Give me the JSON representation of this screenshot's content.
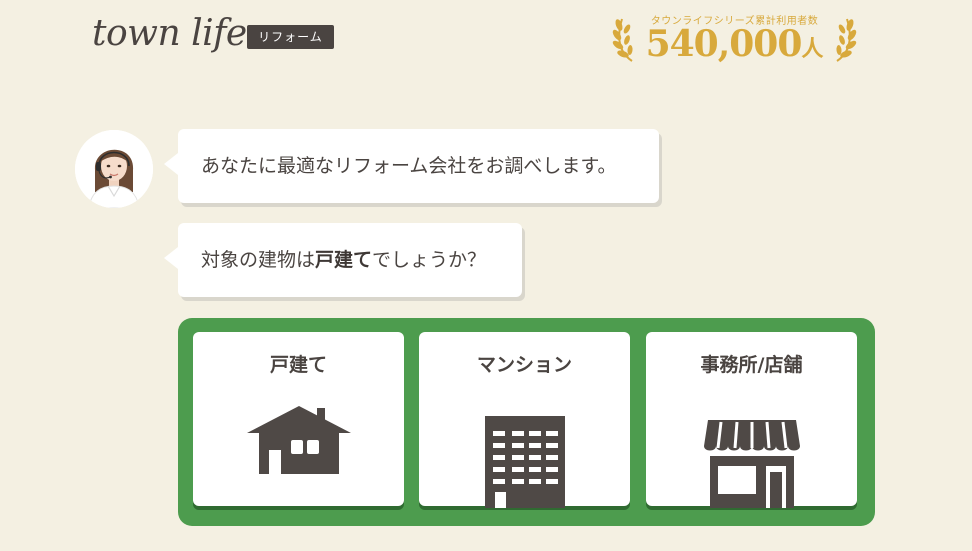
{
  "header": {
    "logo_text": "town life",
    "logo_badge": "リフォーム",
    "stat_caption": "タウンライフシリーズ累計利用者数",
    "stat_number": "540,000",
    "stat_unit": "人"
  },
  "chat": {
    "message_1": "あなたに最適なリフォーム会社をお調べします。",
    "message_2_prefix": "対象の建物は",
    "message_2_emphasis": "戸建て",
    "message_2_suffix": "でしょうか？"
  },
  "options": [
    {
      "label": "戸建て",
      "icon": "house-icon"
    },
    {
      "label": "マンション",
      "icon": "apartment-building-icon"
    },
    {
      "label": "事務所/店舗",
      "icon": "storefront-icon"
    }
  ],
  "colors": {
    "background": "#f4f0e2",
    "text": "#4a4441",
    "accent_gold": "#d8a93c",
    "panel_green": "#4d9c4e",
    "icon_fill": "#4f4946"
  }
}
